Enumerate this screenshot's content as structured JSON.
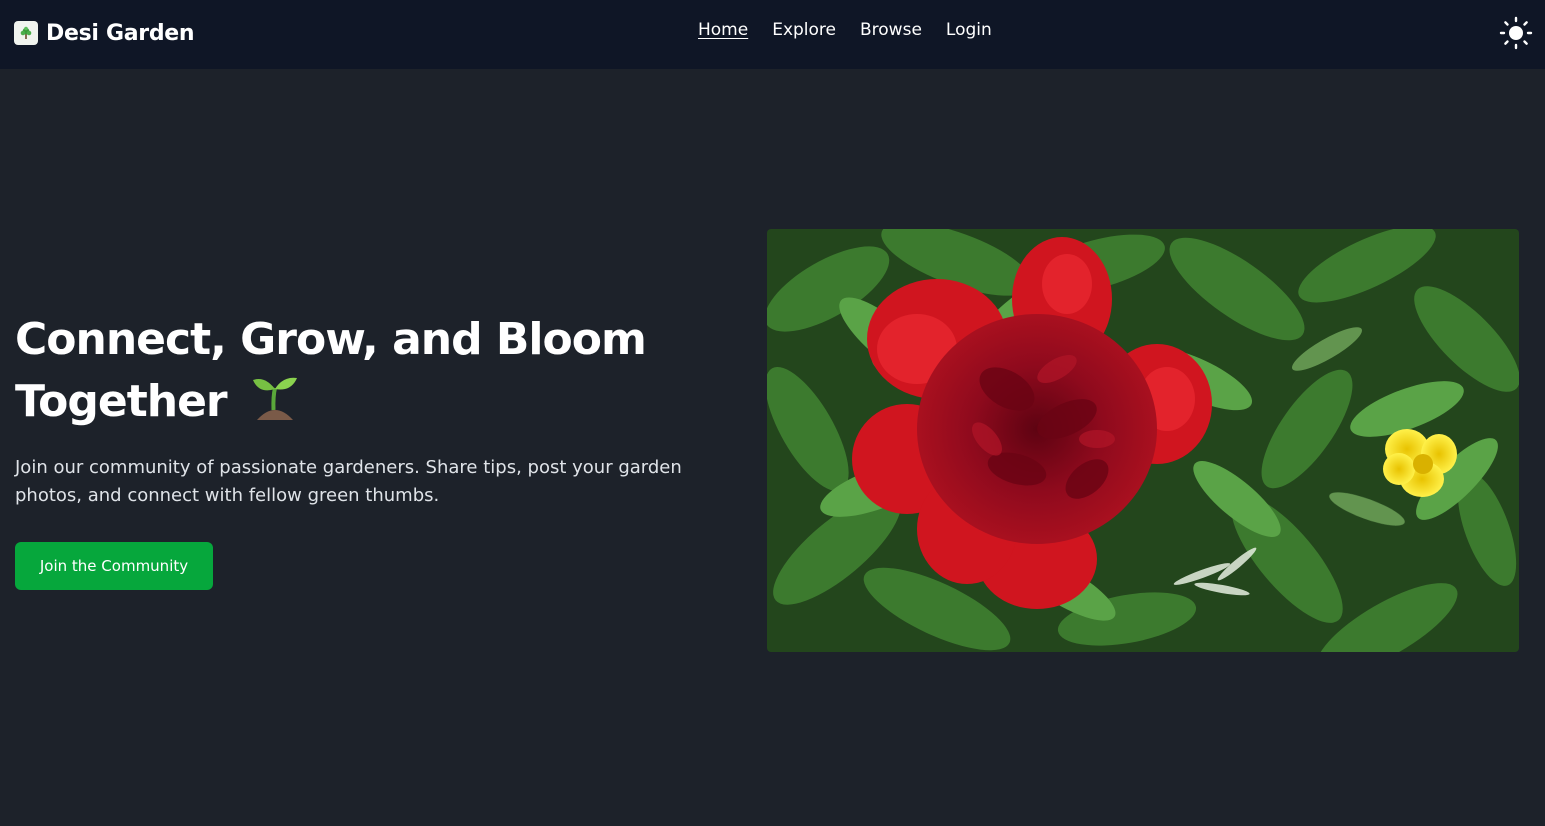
{
  "nav": {
    "brand": "Desi Garden",
    "links": [
      {
        "label": "Home",
        "active": true
      },
      {
        "label": "Explore",
        "active": false
      },
      {
        "label": "Browse",
        "active": false
      },
      {
        "label": "Login",
        "active": false
      }
    ],
    "theme_icon": "sun-icon"
  },
  "hero": {
    "title_line1": "Connect, Grow, and Bloom",
    "title_line2": "Together",
    "title_icon": "sprout-icon",
    "subtitle": "Join our community of passionate gardeners. Share tips, post your garden photos, and connect with fellow green thumbs.",
    "cta_label": "Join the Community"
  },
  "colors": {
    "navbar_bg": "#0f1626",
    "page_bg": "#1d222a",
    "accent": "#06a73c"
  }
}
